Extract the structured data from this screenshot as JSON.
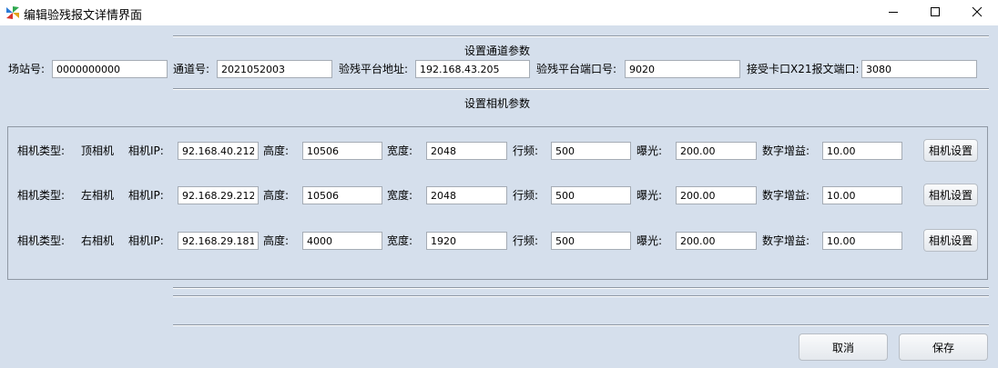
{
  "window": {
    "title": "编辑验残报文详情界面",
    "icons": {
      "app": "pinwheel-icon",
      "minimize": "minimize-icon",
      "maximize": "maximize-icon",
      "close": "close-icon"
    }
  },
  "channel": {
    "section_title": "设置通道参数",
    "station": {
      "label": "场站号:",
      "value": "0000000000"
    },
    "channel_no": {
      "label": "通道号:",
      "value": "2021052003"
    },
    "platform_addr": {
      "label": "验残平台地址:",
      "value": "192.168.43.205"
    },
    "platform_port": {
      "label": "验残平台端口号:",
      "value": "9020"
    },
    "x21_port": {
      "label": "接受卡口X21报文端口:",
      "value": "3080"
    }
  },
  "camera": {
    "section_title": "设置相机参数",
    "labels": {
      "type": "相机类型:",
      "ip": "相机IP:",
      "height": "高度:",
      "width": "宽度:",
      "line_freq": "行频:",
      "exposure": "曝光:",
      "gain": "数字增益:"
    },
    "rows": [
      {
        "type": "顶相机",
        "ip": "92.168.40.212",
        "height": "10506",
        "width": "2048",
        "line_freq": "500",
        "exposure": "200.00",
        "gain": "10.00",
        "button": "相机设置"
      },
      {
        "type": "左相机",
        "ip": "92.168.29.212",
        "height": "10506",
        "width": "2048",
        "line_freq": "500",
        "exposure": "200.00",
        "gain": "10.00",
        "button": "相机设置"
      },
      {
        "type": "右相机",
        "ip": "92.168.29.181",
        "height": "4000",
        "width": "1920",
        "line_freq": "500",
        "exposure": "200.00",
        "gain": "10.00",
        "button": "相机设置"
      }
    ]
  },
  "footer": {
    "cancel_label": "取消",
    "save_label": "保存"
  }
}
